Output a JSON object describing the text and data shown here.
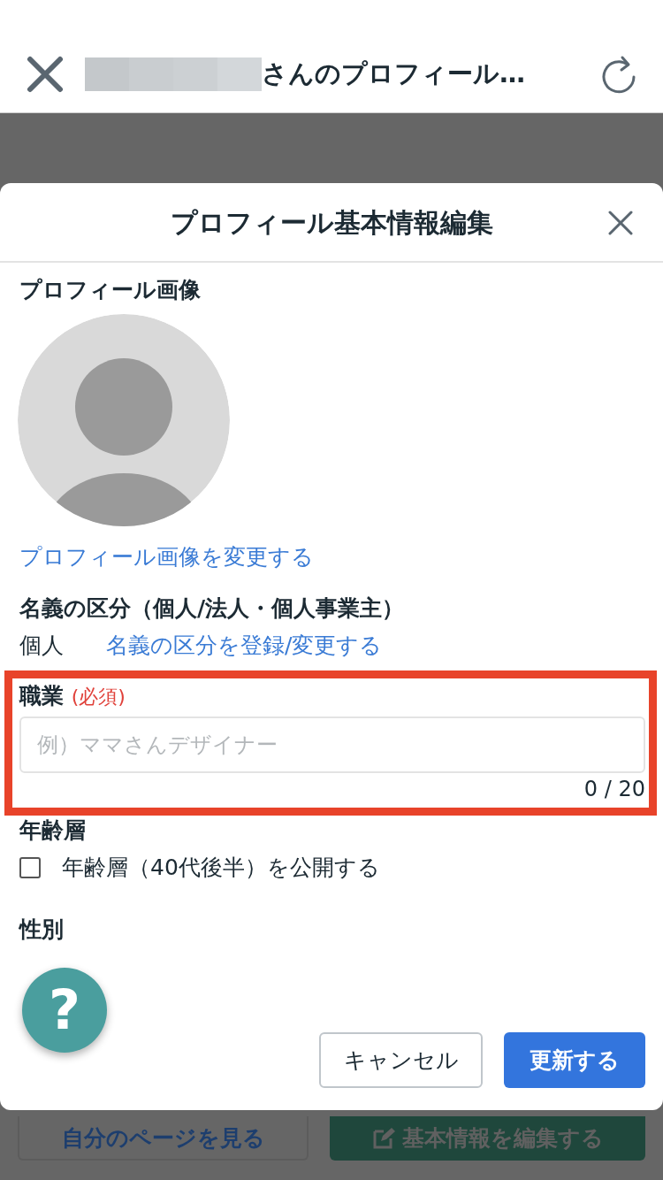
{
  "top_bar": {
    "title": "さんのプロフィール…"
  },
  "modal": {
    "title": "プロフィール基本情報編集",
    "profile_image": {
      "label": "プロフィール画像",
      "change_link": "プロフィール画像を変更する"
    },
    "account_type": {
      "label": "名義の区分（個人/法人・個人事業主）",
      "value": "個人",
      "change_link": "名義の区分を登録/変更する"
    },
    "occupation": {
      "label": "職業",
      "required": "(必須)",
      "placeholder": "例）ママさんデザイナー",
      "counter": "0 / 20",
      "highlighted": true
    },
    "age": {
      "label": "年齢層",
      "checkbox": {
        "label": "年齢層（40代後半）を公開する",
        "checked": false
      }
    },
    "gender": {
      "label": "性別"
    },
    "buttons": [
      {
        "label": "キャンセル",
        "kind": "secondary"
      },
      {
        "label": "更新する",
        "kind": "primary"
      }
    ]
  },
  "help_button": {
    "label": "?"
  },
  "background_buttons": [
    {
      "label": "自分のページを見る",
      "kind": "outline"
    },
    {
      "label": "基本情報を編集する",
      "kind": "edit"
    }
  ]
}
